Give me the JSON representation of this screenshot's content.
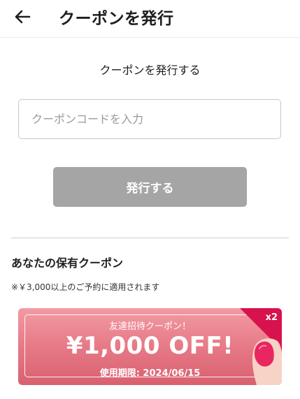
{
  "header": {
    "title": "クーポンを発行",
    "back_icon": "arrow-left-icon"
  },
  "issue": {
    "title": "クーポンを発行する",
    "input_placeholder": "クーポンコードを入力",
    "input_value": "",
    "button_label": "発行する"
  },
  "owned": {
    "title": "あなたの保有クーポン",
    "note": "※￥3,000以上のご予約に適用されます",
    "coupons": [
      {
        "subtitle": "友達招待クーポン！",
        "amount": "¥1,000 OFF!",
        "expiry": "使用期限: 2024/06/15",
        "count": "x2",
        "icon": "nail-icon"
      }
    ]
  },
  "colors": {
    "button_disabled": "#a5a5a5",
    "coupon_pink": "#e57784",
    "corner_red": "#d8124c",
    "nail_pink": "#e8265f"
  }
}
